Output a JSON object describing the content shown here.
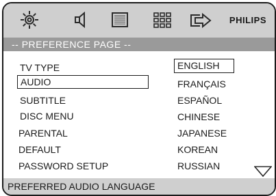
{
  "brand": "PHILIPS",
  "page_title": "-- PREFERENCE PAGE --",
  "menu_items": [
    "TV TYPE",
    "AUDIO",
    "SUBTITLE",
    "DISC MENU",
    "PARENTAL",
    "DEFAULT",
    "PASSWORD SETUP"
  ],
  "selected_menu_item": "AUDIO",
  "options": [
    "ENGLISH",
    "FRANÇAIS",
    "ESPAÑOL",
    "CHINESE",
    "JAPANESE",
    "KOREAN",
    "RUSSIAN"
  ],
  "selected_option": "ENGLISH",
  "footer_text": "PREFERRED AUDIO LANGUAGE",
  "icons": [
    "general-setup-gear-icon",
    "audio-speaker-icon",
    "video-screen-icon",
    "preference-grid-icon",
    "exit-arrow-icon",
    "scroll-down-triangle-icon"
  ]
}
